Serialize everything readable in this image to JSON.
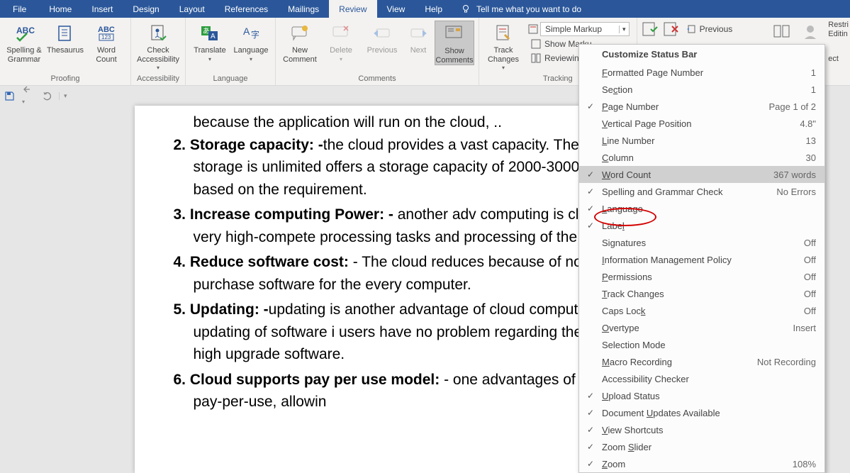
{
  "tabs": {
    "file": "File",
    "items": [
      "Home",
      "Insert",
      "Design",
      "Layout",
      "References",
      "Mailings",
      "Review",
      "View",
      "Help"
    ],
    "active_index": 6,
    "tellme_placeholder": "Tell me what you want to do"
  },
  "ribbon": {
    "proofing": {
      "label": "Proofing",
      "spelling": "Spelling &\nGrammar",
      "thesaurus": "Thesaurus",
      "wordcount": "Word\nCount"
    },
    "accessibility": {
      "label": "Accessibility",
      "check": "Check\nAccessibility"
    },
    "language": {
      "label": "Language",
      "translate": "Translate",
      "language": "Language"
    },
    "comments": {
      "label": "Comments",
      "new": "New\nComment",
      "delete": "Delete",
      "previous": "Previous",
      "next": "Next",
      "show": "Show\nComments"
    },
    "tracking": {
      "label": "Tracking",
      "track": "Track\nChanges",
      "simple": "Simple Markup",
      "showmarkup": "Show Marku",
      "reviewing": "Reviewing Pa"
    },
    "compare": {
      "previous": "Previous"
    },
    "editing": {
      "restrict": "Restri",
      "editing": "Editin",
      "ect": "ect"
    }
  },
  "doc": {
    "item1_tail": "because the application will run on the cloud, ..",
    "items": [
      {
        "n": "2.",
        "h": "Storage capacity: -",
        "t": "the cloud provides a vast  capacity. The size of cloud storage is unlimited  offers a storage capacity of 2000-3000 GBs or   is based on the requirement."
      },
      {
        "n": "3.",
        "h": "Increase computing Power: -",
        "t": " another adv  computing is cloud serves a very high-compete  processing tasks and processing of the applicati"
      },
      {
        "n": "4.",
        "h": "Reduce software cost:",
        "t": " - The cloud reduces   because of no need to purchase software for the  every computer."
      },
      {
        "n": "5.",
        "h": "Updating: -",
        "t": "updating is another advantage of  cloud computing, instant updating of software i  users have no problem regarding the choice bet  high upgrade software."
      },
      {
        "n": "6.",
        "h": "Cloud supports pay per use model:",
        "t": " - one  advantages of the cloud is pay-per-use, allowin"
      }
    ]
  },
  "menu": {
    "title": "Customize Status Bar",
    "items": [
      {
        "chk": false,
        "lbl": "Formatted Page Number",
        "u": 0,
        "val": "1"
      },
      {
        "chk": false,
        "lbl": "Section",
        "u": 2,
        "val": "1"
      },
      {
        "chk": true,
        "lbl": "Page Number",
        "u": 0,
        "val": "Page 1 of 2"
      },
      {
        "chk": false,
        "lbl": "Vertical Page Position",
        "u": 0,
        "val": "4.8\""
      },
      {
        "chk": false,
        "lbl": "Line Number",
        "u": 0,
        "val": "13"
      },
      {
        "chk": false,
        "lbl": "Column",
        "u": 0,
        "val": "30"
      },
      {
        "chk": true,
        "lbl": "Word Count",
        "u": 0,
        "val": "367 words",
        "hl": true
      },
      {
        "chk": true,
        "lbl": "Spelling and Grammar Check",
        "u": -1,
        "val": "No Errors"
      },
      {
        "chk": true,
        "lbl": "Language",
        "u": 0,
        "val": ""
      },
      {
        "chk": true,
        "lbl": "Label",
        "u": 4,
        "val": ""
      },
      {
        "chk": false,
        "lbl": "Signatures",
        "u": 2,
        "val": "Off"
      },
      {
        "chk": false,
        "lbl": "Information Management Policy",
        "u": 0,
        "val": "Off"
      },
      {
        "chk": false,
        "lbl": "Permissions",
        "u": 0,
        "val": "Off"
      },
      {
        "chk": false,
        "lbl": "Track Changes",
        "u": 0,
        "val": "Off"
      },
      {
        "chk": false,
        "lbl": "Caps Lock",
        "u": 8,
        "val": "Off"
      },
      {
        "chk": false,
        "lbl": "Overtype",
        "u": 0,
        "val": "Insert"
      },
      {
        "chk": false,
        "lbl": "Selection Mode",
        "u": -1,
        "val": ""
      },
      {
        "chk": false,
        "lbl": "Macro Recording",
        "u": 0,
        "val": "Not Recording"
      },
      {
        "chk": false,
        "lbl": "Accessibility Checker",
        "u": -1,
        "val": ""
      },
      {
        "chk": true,
        "lbl": "Upload Status",
        "u": 0,
        "val": ""
      },
      {
        "chk": true,
        "lbl": "Document Updates Available",
        "u": 9,
        "val": ""
      },
      {
        "chk": true,
        "lbl": "View Shortcuts",
        "u": 0,
        "val": ""
      },
      {
        "chk": true,
        "lbl": "Zoom Slider",
        "u": 5,
        "val": ""
      },
      {
        "chk": true,
        "lbl": "Zoom",
        "u": 0,
        "val": "108%"
      }
    ]
  }
}
